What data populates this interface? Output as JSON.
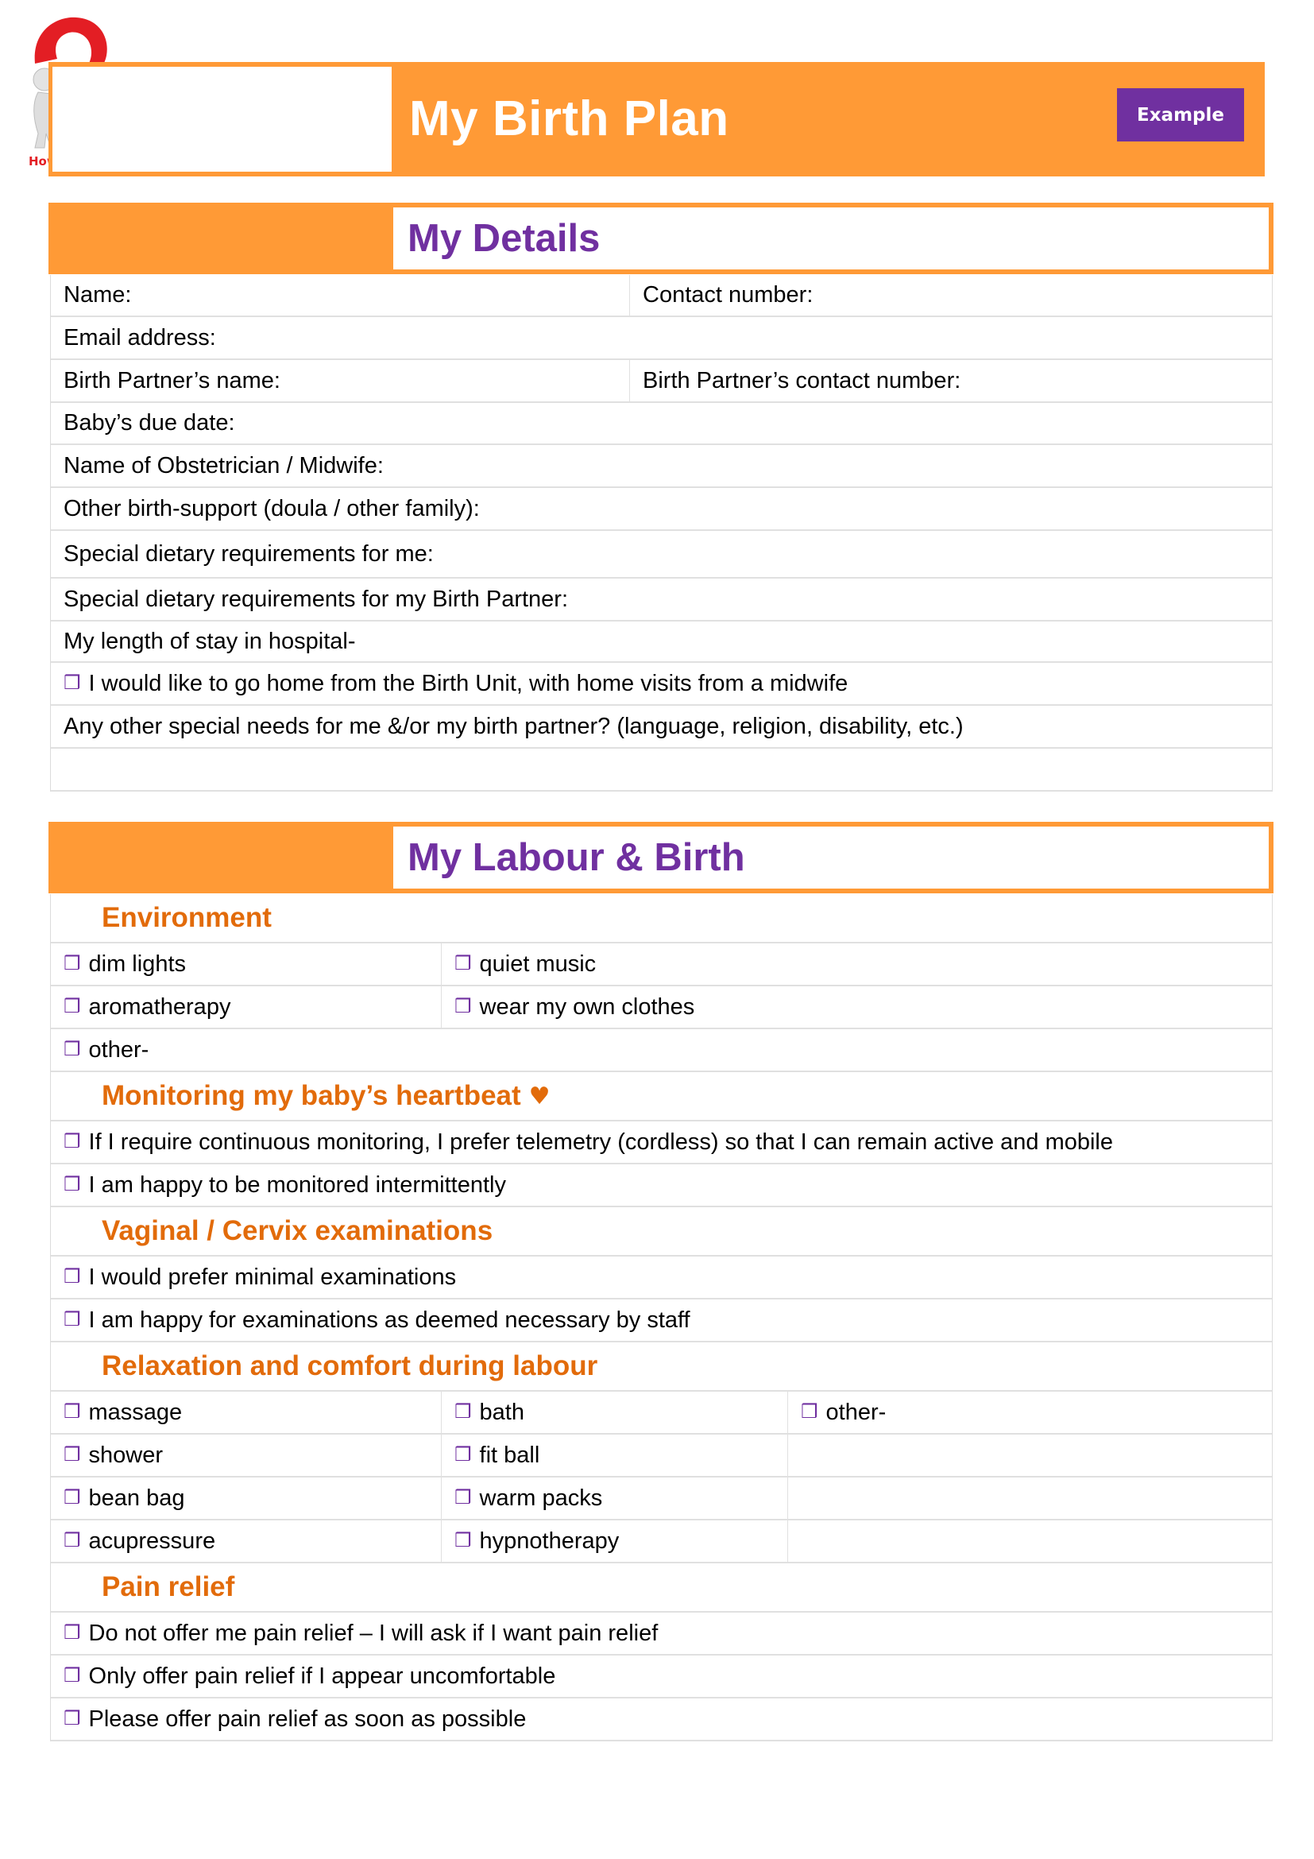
{
  "logo": {
    "icon": "question-mark-figure-icon",
    "text": "How To Wiki"
  },
  "header": {
    "title": "My Birth Plan",
    "badge": "Example"
  },
  "colors": {
    "orange": "#ff9a36",
    "purple": "#7030a0",
    "heading_orange": "#e26b0a",
    "red": "#e31e24"
  },
  "checkbox_glyph": "❒",
  "details": {
    "title": "My Details",
    "rows": [
      [
        "Name:",
        "Contact number:"
      ],
      [
        "Email address:"
      ],
      [
        "Birth Partner’s name:",
        "Birth Partner’s contact number:"
      ],
      [
        "Baby’s due date:"
      ],
      [
        "Name of Obstetrician / Midwife:"
      ],
      [
        "Other birth-support (doula / other family):"
      ],
      [
        "Special dietary requirements for me:"
      ],
      [
        "Special dietary requirements for my Birth Partner:"
      ],
      [
        "My length of stay in hospital-"
      ],
      [
        "I would like to go home from the Birth Unit, with home visits from a midwife"
      ],
      [
        "Any other special needs for me &/or my birth partner? (language, religion, disability, etc.)"
      ],
      [
        ""
      ]
    ]
  },
  "labour": {
    "title": "My Labour & Birth",
    "environment": {
      "heading": "Environment",
      "options": [
        [
          "dim lights",
          "quiet music"
        ],
        [
          "aromatherapy",
          "wear my own clothes"
        ],
        [
          "other-"
        ]
      ]
    },
    "monitoring": {
      "heading": "Monitoring my baby’s heartbeat",
      "heading_icon": "heart-icon",
      "options": [
        "If I require continuous monitoring, I prefer telemetry (cordless) so that I can remain active and mobile",
        "I am happy to be monitored intermittently"
      ]
    },
    "examinations": {
      "heading": "Vaginal / Cervix examinations",
      "options": [
        "I would prefer minimal examinations",
        "I am happy for examinations as deemed necessary by staff"
      ]
    },
    "relaxation": {
      "heading": "Relaxation and comfort during labour",
      "options": [
        [
          "massage",
          "bath",
          "other-"
        ],
        [
          "shower",
          "fit ball",
          ""
        ],
        [
          "bean bag",
          "warm packs",
          ""
        ],
        [
          "acupressure",
          "hypnotherapy",
          ""
        ]
      ]
    },
    "pain_relief": {
      "heading": "Pain relief",
      "options": [
        "Do not offer me pain relief – I will ask if I want pain relief",
        "Only offer pain relief if I appear uncomfortable",
        "Please offer pain relief as soon as possible"
      ]
    }
  }
}
